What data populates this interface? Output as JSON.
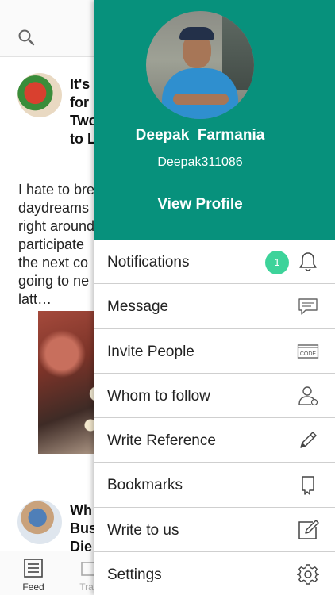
{
  "feed": {
    "post1": {
      "title_lines": "It's\nfor\nTwo\nto L"
    },
    "post1_body": "I hate to bre\ndaydreams\nright around\nparticipate\nthe next co\ngoing to ne\nlatt…",
    "post2": {
      "title_lines": "Wh\nBus\nDie"
    },
    "bottom_nav": {
      "feed_label": "Feed",
      "travel_label": "Trav"
    }
  },
  "drawer": {
    "profile": {
      "name": "Deepak  Farmania",
      "username": "Deepak311086",
      "view_profile": "View Profile"
    },
    "menu": [
      {
        "label": "Notifications",
        "icon": "bell-icon",
        "badge": "1"
      },
      {
        "label": "Message",
        "icon": "message-icon"
      },
      {
        "label": "Invite People",
        "icon": "code-icon",
        "icon_text": "CODE"
      },
      {
        "label": "Whom to follow",
        "icon": "follow-user-icon"
      },
      {
        "label": "Write Reference",
        "icon": "pencil-icon"
      },
      {
        "label": "Bookmarks",
        "icon": "bookmark-icon"
      },
      {
        "label": "Write to us",
        "icon": "edit-icon"
      },
      {
        "label": "Settings",
        "icon": "gear-icon"
      }
    ]
  },
  "colors": {
    "header": "#07917c",
    "badge": "#3dd39a"
  }
}
